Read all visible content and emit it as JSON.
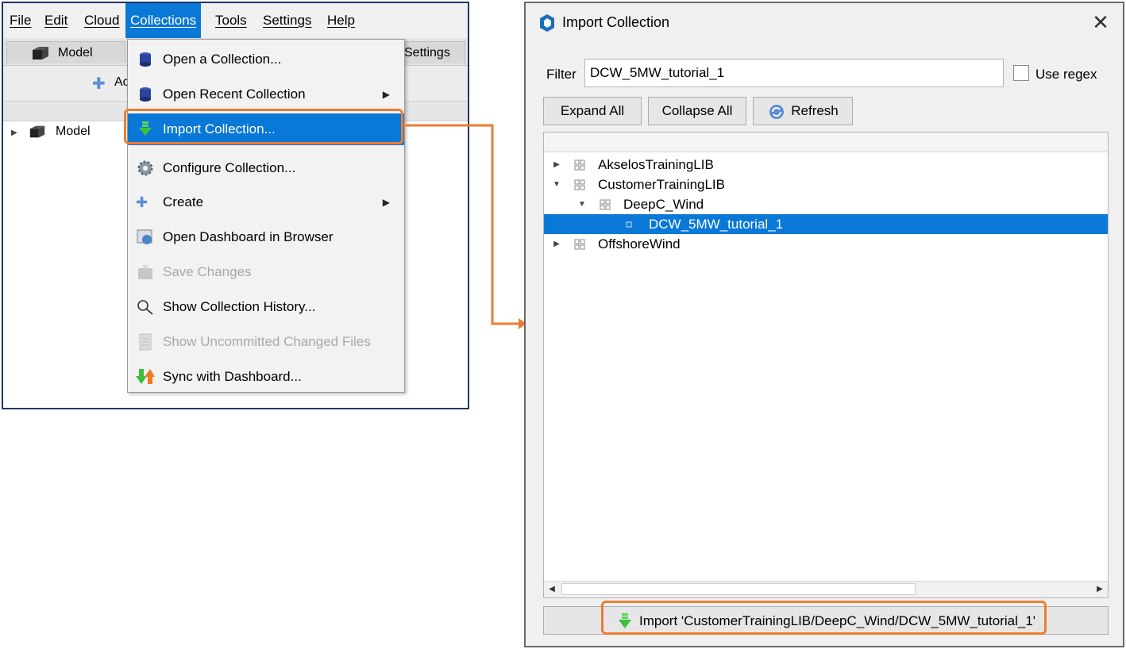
{
  "app": {
    "menubar": [
      "File",
      "Edit",
      "Cloud",
      "Collections",
      "Tools",
      "Settings",
      "Help"
    ],
    "tabs": [
      "Model",
      "Settings"
    ],
    "toolbar_add_label": "Ac",
    "tree_root": "Model"
  },
  "collections_menu": {
    "items": [
      {
        "label": "Open a Collection...",
        "icon": "open-collection-icon",
        "enabled": true,
        "submenu": false
      },
      {
        "label": "Open Recent Collection",
        "icon": "recent-collection-icon",
        "enabled": true,
        "submenu": true
      },
      {
        "label": "Import Collection...",
        "icon": "import-icon",
        "enabled": true,
        "submenu": false,
        "highlighted": true
      },
      {
        "label": "Configure Collection...",
        "icon": "gear-icon",
        "enabled": true,
        "submenu": false
      },
      {
        "label": "Create",
        "icon": "plus-icon",
        "enabled": true,
        "submenu": true
      },
      {
        "label": "Open Dashboard in Browser",
        "icon": "browser-icon",
        "enabled": true,
        "submenu": false
      },
      {
        "label": "Save Changes",
        "icon": "save-icon",
        "enabled": false,
        "submenu": false
      },
      {
        "label": "Show Collection History...",
        "icon": "magnifier-icon",
        "enabled": true,
        "submenu": false
      },
      {
        "label": "Show Uncommitted Changed Files",
        "icon": "file-icon",
        "enabled": false,
        "submenu": false
      },
      {
        "label": "Sync with Dashboard...",
        "icon": "sync-icon",
        "enabled": true,
        "submenu": false
      }
    ]
  },
  "import_dialog": {
    "title": "Import Collection",
    "close_glyph": "✕",
    "filter_label": "Filter",
    "filter_value": "DCW_5MW_tutorial_1",
    "use_regex_label": "Use regex",
    "use_regex_checked": false,
    "buttons": {
      "expand_all": "Expand All",
      "collapse_all": "Collapse All",
      "refresh": "Refresh"
    },
    "tree": [
      {
        "label": "AkselosTrainingLIB",
        "depth": 0,
        "expanded": false,
        "selected": false
      },
      {
        "label": "CustomerTrainingLIB",
        "depth": 0,
        "expanded": true,
        "selected": false
      },
      {
        "label": "DeepC_Wind",
        "depth": 1,
        "expanded": true,
        "selected": false
      },
      {
        "label": "DCW_5MW_tutorial_1",
        "depth": 2,
        "leaf": true,
        "selected": true
      },
      {
        "label": "OffshoreWind",
        "depth": 0,
        "expanded": false,
        "selected": false
      }
    ],
    "import_button_label": "Import 'CustomerTrainingLIB/DeepC_Wind/DCW_5MW_tutorial_1'"
  },
  "colors": {
    "accent": "#0a78d7",
    "callout": "#ed7d31",
    "window_border": "#1f3864"
  }
}
